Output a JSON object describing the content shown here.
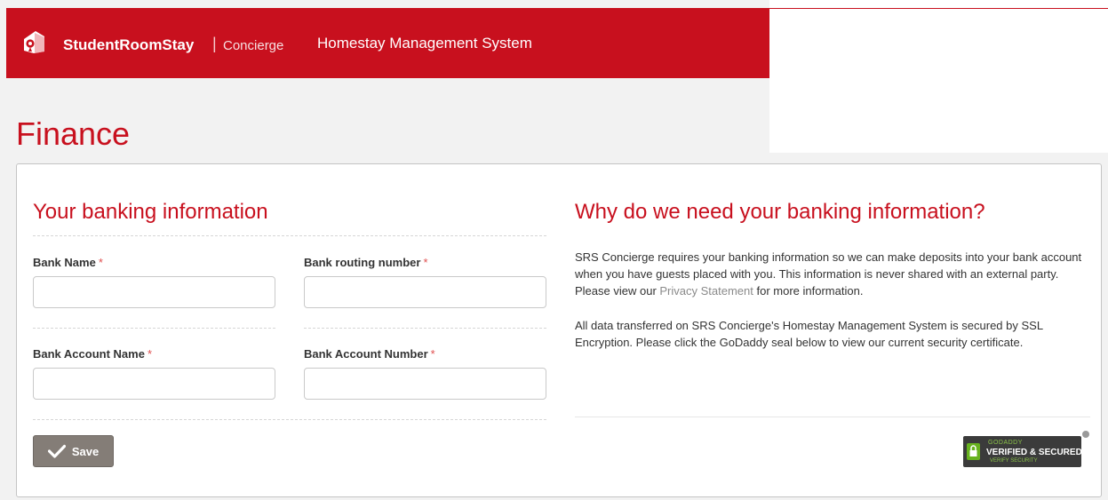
{
  "header": {
    "brand_name": "StudentRoomStay",
    "brand_sub": "Concierge",
    "app_title": "Homestay Management System",
    "brand_color": "#c8101e"
  },
  "page": {
    "title": "Finance"
  },
  "banking": {
    "title": "Your banking information",
    "bank_name_label": "Bank Name",
    "routing_label": "Bank routing number",
    "account_name_label": "Bank Account Name",
    "account_number_label": "Bank Account Number",
    "required_marker": "*",
    "bank_name_value": "",
    "routing_value": "",
    "account_name_value": "",
    "account_number_value": "",
    "save_label": "Save"
  },
  "why": {
    "title": "Why do we need your banking information?",
    "para1_before": "SRS Concierge requires your banking information so we can make deposits into your bank account when you have guests placed with you. This information is never shared with an external party. Please view our ",
    "privacy_link": "Privacy Statement",
    "para1_after": " for more information.",
    "para2": "All data transferred on SRS Concierge's Homestay Management System is secured by SSL Encryption. Please click the GoDaddy seal below to view our current security certificate."
  },
  "seal": {
    "brand": "GODADDY",
    "text": "VERIFIED & SECURED",
    "sub": "VERIFY SECURITY"
  },
  "icons": {
    "logo": "srs-house-logo-icon",
    "save": "checkmark-icon",
    "seal_lock": "lock-icon"
  }
}
